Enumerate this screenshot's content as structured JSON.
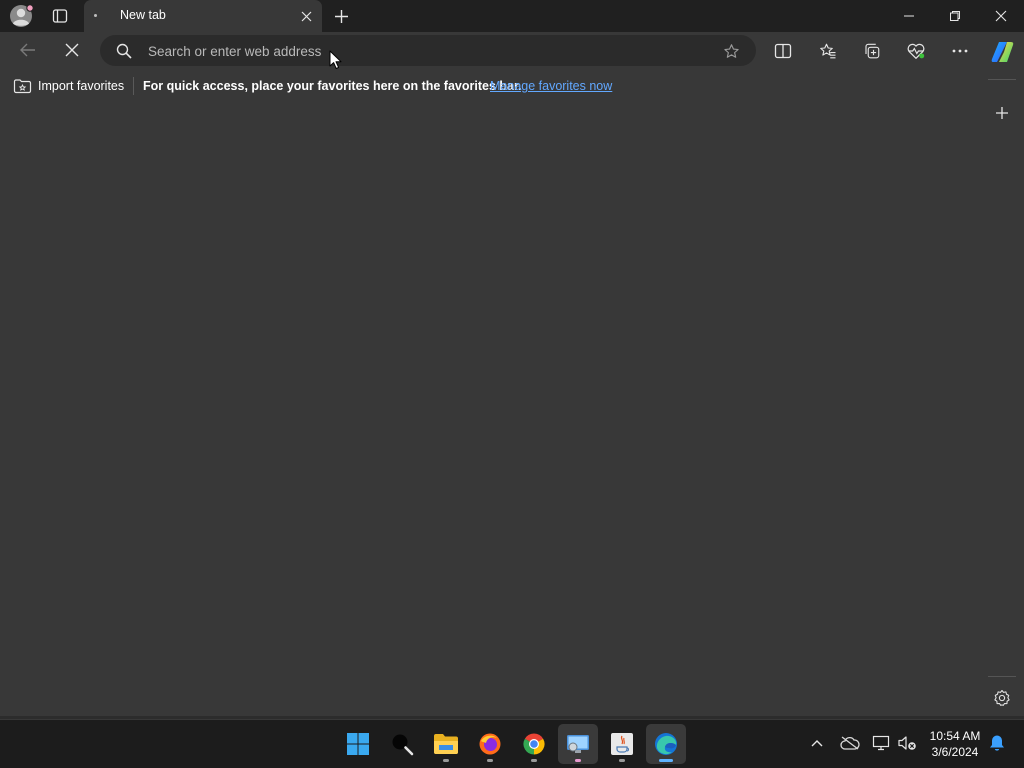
{
  "tab": {
    "title": "New tab"
  },
  "address_bar": {
    "placeholder": "Search or enter web address",
    "value": ""
  },
  "favorites_bar": {
    "import_label": "Import favorites",
    "message": "For quick access, place your favorites here on the favorites bar.",
    "link": "Manage favorites now"
  },
  "taskbar": {
    "apps": [
      "start",
      "search",
      "file-explorer",
      "firefox",
      "chrome",
      "remote-desktop",
      "java",
      "edge"
    ],
    "time": "10:54 AM",
    "date": "3/6/2024"
  },
  "colors": {
    "titlebar": "#202020",
    "page": "#383838",
    "addressbar": "#2b2b2b",
    "link": "#62a8ff",
    "taskbar": "#1c1c1c",
    "edge_indicator": "#5fb2ff"
  }
}
